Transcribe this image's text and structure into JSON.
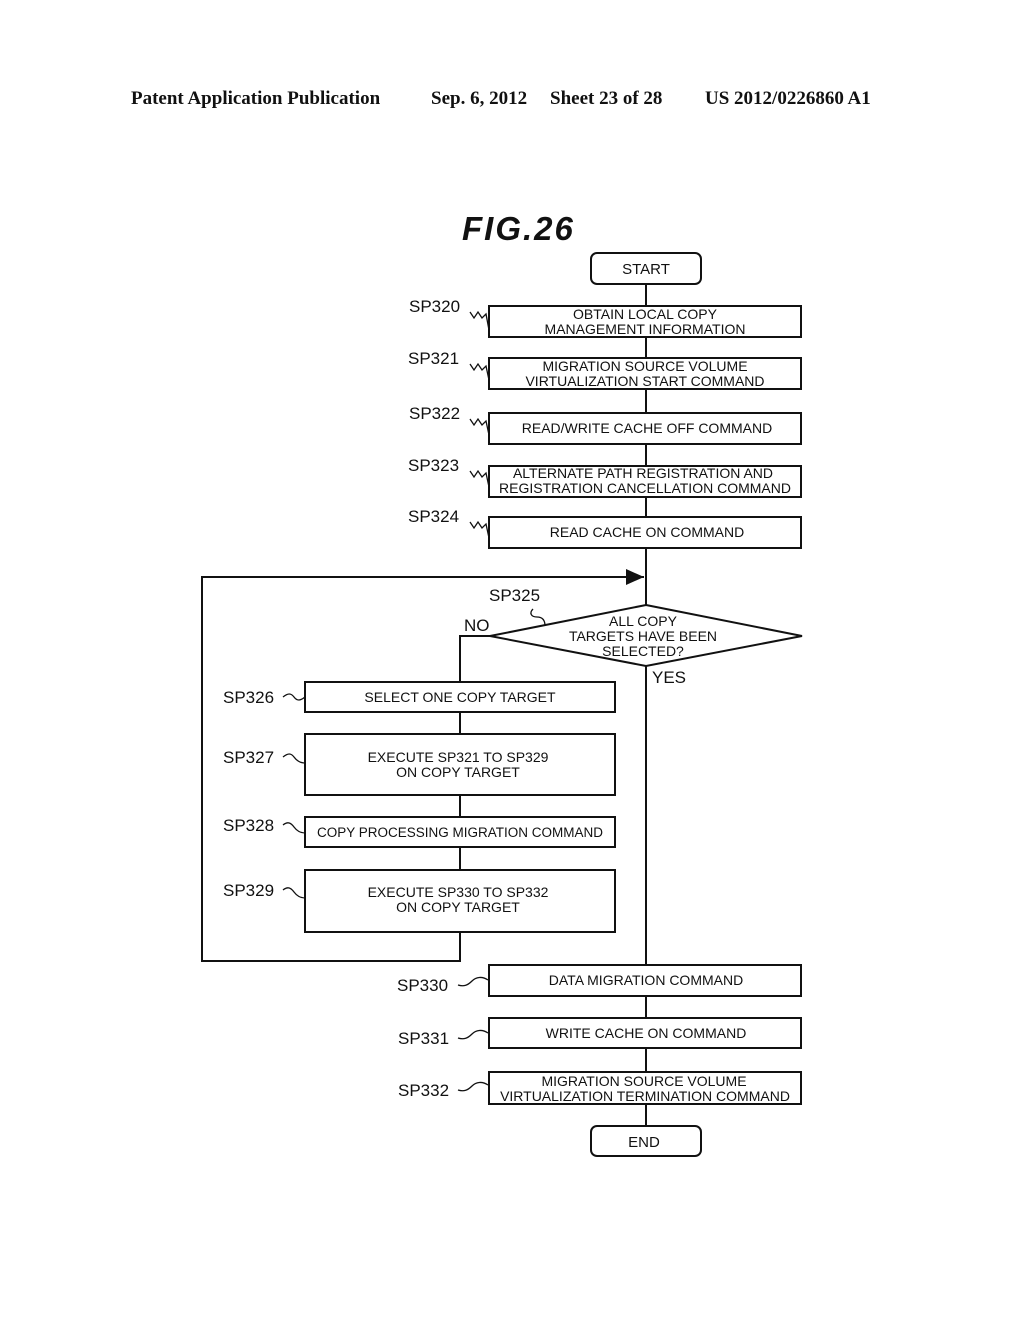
{
  "header": {
    "publication": "Patent Application Publication",
    "date": "Sep. 6, 2012",
    "sheet": "Sheet 23 of 28",
    "number": "US 2012/0226860 A1"
  },
  "figure": {
    "title": "FIG.26"
  },
  "flowchart": {
    "start": "START",
    "end": "END",
    "steps": {
      "sp320": {
        "label": "SP320",
        "lines": [
          "OBTAIN LOCAL COPY",
          "MANAGEMENT INFORMATION"
        ]
      },
      "sp321": {
        "label": "SP321",
        "lines": [
          "MIGRATION SOURCE VOLUME",
          "VIRTUALIZATION START COMMAND"
        ]
      },
      "sp322": {
        "label": "SP322",
        "lines": [
          "READ/WRITE CACHE OFF COMMAND"
        ]
      },
      "sp323": {
        "label": "SP323",
        "lines": [
          "ALTERNATE PATH REGISTRATION AND",
          "REGISTRATION CANCELLATION COMMAND"
        ]
      },
      "sp324": {
        "label": "SP324",
        "lines": [
          "READ CACHE ON COMMAND"
        ]
      },
      "sp325": {
        "label": "SP325",
        "lines": [
          "ALL COPY",
          "TARGETS HAVE BEEN",
          "SELECTED?"
        ],
        "no": "NO",
        "yes": "YES"
      },
      "sp326": {
        "label": "SP326",
        "lines": [
          "SELECT ONE COPY TARGET"
        ]
      },
      "sp327": {
        "label": "SP327",
        "lines": [
          "EXECUTE SP321 TO SP329",
          "ON COPY TARGET"
        ]
      },
      "sp328": {
        "label": "SP328",
        "lines": [
          "COPY PROCESSING MIGRATION COMMAND"
        ]
      },
      "sp329": {
        "label": "SP329",
        "lines": [
          "EXECUTE SP330 TO SP332",
          "ON COPY TARGET"
        ]
      },
      "sp330": {
        "label": "SP330",
        "lines": [
          "DATA MIGRATION COMMAND"
        ]
      },
      "sp331": {
        "label": "SP331",
        "lines": [
          "WRITE CACHE ON COMMAND"
        ]
      },
      "sp332": {
        "label": "SP332",
        "lines": [
          "MIGRATION SOURCE VOLUME",
          "VIRTUALIZATION TERMINATION COMMAND"
        ]
      }
    }
  }
}
